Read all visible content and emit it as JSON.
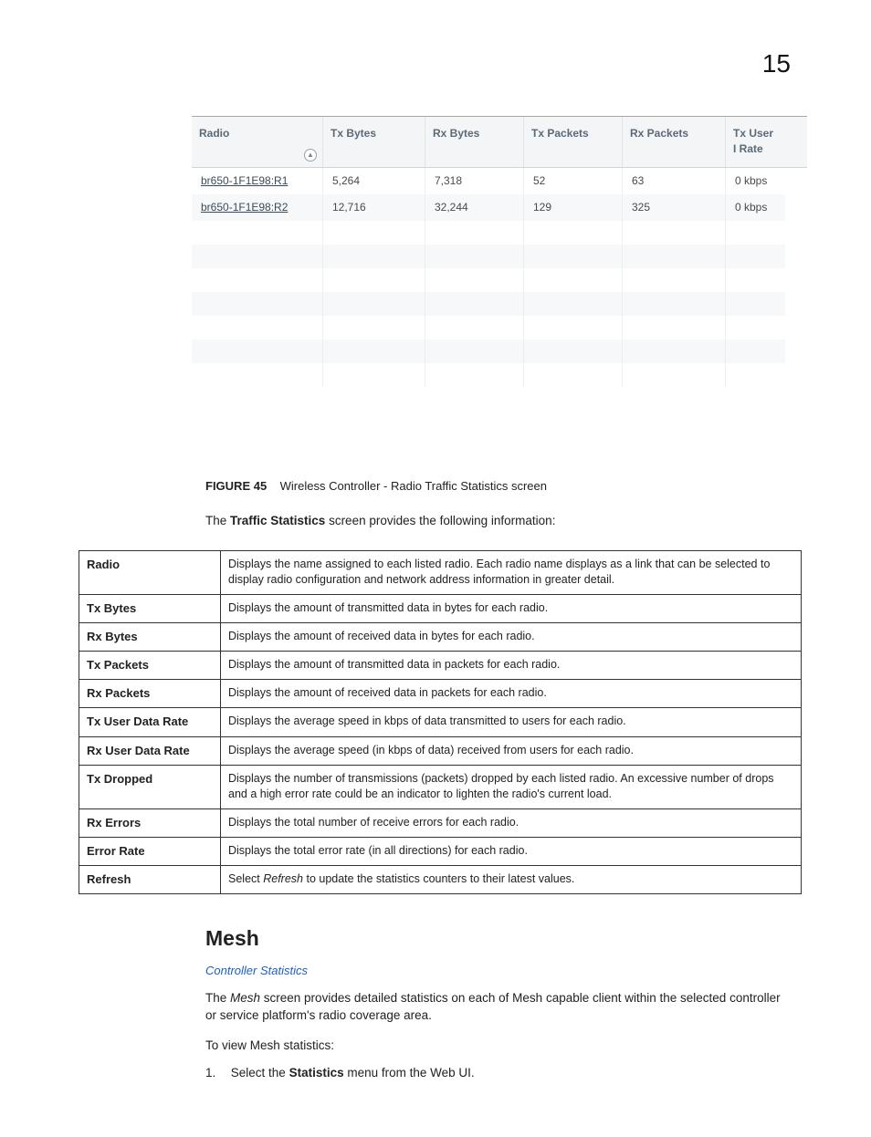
{
  "page_number": "15",
  "stats_table": {
    "headers": {
      "radio": "Radio",
      "tx_bytes": "Tx Bytes",
      "rx_bytes": "Rx Bytes",
      "tx_packets": "Tx Packets",
      "rx_packets": "Rx Packets",
      "tx_user_rate": "Tx User I Rate"
    },
    "sort_glyph": "▲",
    "rows": [
      {
        "radio": "br650-1F1E98:R1",
        "tx_bytes": "5,264",
        "rx_bytes": "7,318",
        "tx_packets": "52",
        "rx_packets": "63",
        "tx_user_rate": "0 kbps"
      },
      {
        "radio": "br650-1F1E98:R2",
        "tx_bytes": "12,716",
        "rx_bytes": "32,244",
        "tx_packets": "129",
        "rx_packets": "325",
        "tx_user_rate": "0 kbps"
      }
    ],
    "empty_rows": 7
  },
  "figure": {
    "label": "FIGURE 45",
    "title": "Wireless Controller - Radio Traffic Statistics screen"
  },
  "intro_pre": "The ",
  "intro_bold": "Traffic Statistics",
  "intro_post": " screen provides the following information:",
  "definitions": [
    {
      "term": "Radio",
      "desc": "Displays the name assigned to each listed radio. Each radio name displays as a link that can be selected to display radio configuration and network address information in greater detail."
    },
    {
      "term": "Tx Bytes",
      "desc": "Displays the amount of transmitted data in bytes for each radio."
    },
    {
      "term": "Rx Bytes",
      "desc": "Displays the amount of received data in bytes for each radio."
    },
    {
      "term": "Tx Packets",
      "desc": "Displays the amount of transmitted data in packets for each radio."
    },
    {
      "term": "Rx Packets",
      "desc": "Displays the amount of received data in packets for each radio."
    },
    {
      "term": "Tx User Data Rate",
      "desc": "Displays the average speed in kbps of data transmitted to users for each radio."
    },
    {
      "term": "Rx User Data Rate",
      "desc": "Displays the average speed (in kbps of data) received from users for each radio."
    },
    {
      "term": "Tx Dropped",
      "desc": "Displays the number of transmissions (packets) dropped by each listed radio. An excessive number of drops and a high error rate could be an indicator to lighten the radio's current load."
    },
    {
      "term": "Rx Errors",
      "desc": "Displays the total number of receive errors for each radio."
    },
    {
      "term": "Error Rate",
      "desc": "Displays the total error rate (in all directions) for each radio."
    },
    {
      "term": "Refresh",
      "desc_pre": "Select ",
      "desc_em": "Refresh",
      "desc_post": " to update the statistics counters to their latest values."
    }
  ],
  "mesh": {
    "heading": "Mesh",
    "subtitle": "Controller Statistics",
    "para_pre": "The ",
    "para_em": "Mesh",
    "para_post": " screen provides detailed statistics on each of Mesh capable client within the selected controller or service platform's radio coverage area.",
    "steps_intro": "To view Mesh statistics:",
    "step1_num": "1.",
    "step1_pre": "Select the ",
    "step1_bold": "Statistics",
    "step1_post": " menu from the Web UI."
  }
}
